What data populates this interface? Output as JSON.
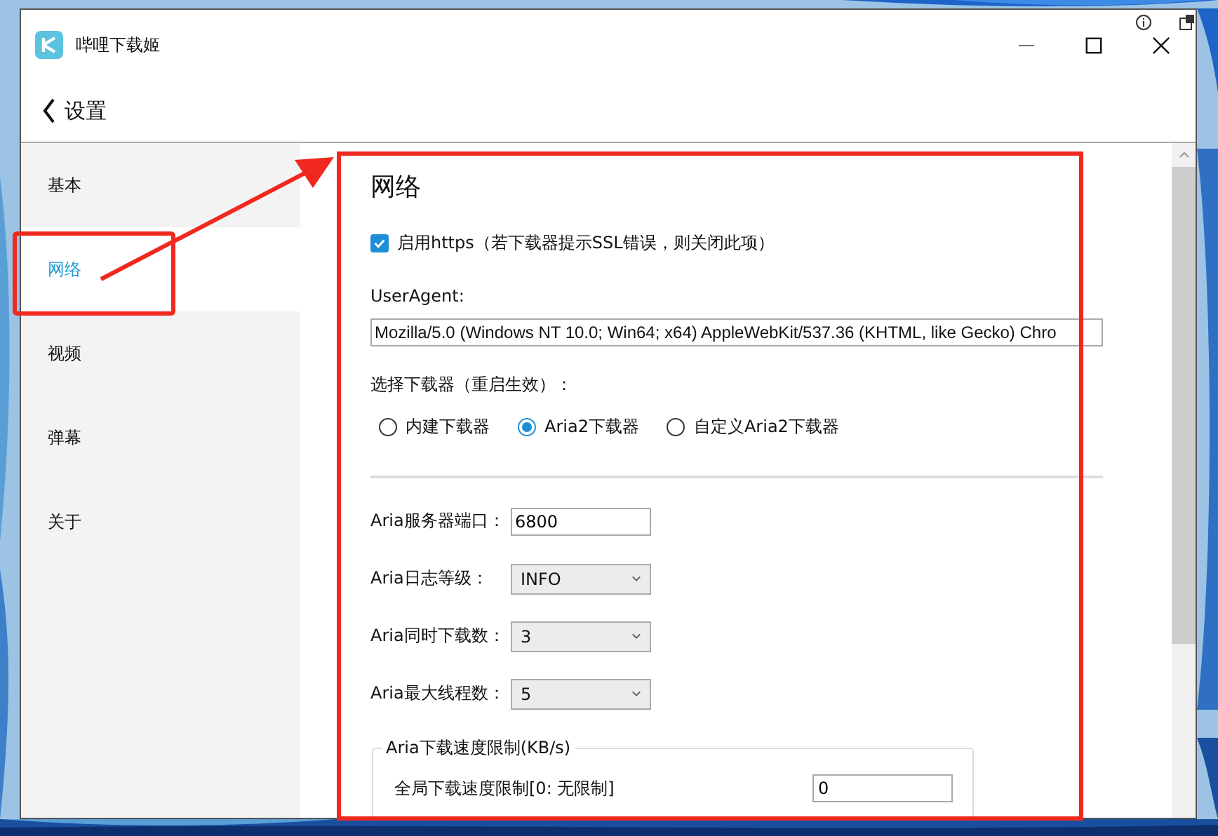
{
  "window": {
    "title": "哔哩下载姬"
  },
  "header": {
    "back_label": "设置"
  },
  "sidebar": {
    "items": [
      {
        "label": "基本",
        "selected": false
      },
      {
        "label": "网络",
        "selected": true
      },
      {
        "label": "视频",
        "selected": false
      },
      {
        "label": "弹幕",
        "selected": false
      },
      {
        "label": "关于",
        "selected": false
      }
    ]
  },
  "content": {
    "title": "网络",
    "https": {
      "label": "启用https（若下载器提示SSL错误，则关闭此项）",
      "checked": true
    },
    "useragent": {
      "label": "UserAgent:",
      "value": "Mozilla/5.0 (Windows NT 10.0; Win64; x64) AppleWebKit/537.36 (KHTML, like Gecko) Chro"
    },
    "downloader": {
      "label": "选择下载器（重启生效）：",
      "options": [
        {
          "label": "内建下载器",
          "selected": false
        },
        {
          "label": "Aria2下载器",
          "selected": true
        },
        {
          "label": "自定义Aria2下载器",
          "selected": false
        }
      ]
    },
    "settings": [
      {
        "kind": "input",
        "label": "Aria服务器端口：",
        "value": "6800"
      },
      {
        "kind": "select",
        "label": "Aria日志等级：",
        "value": "INFO"
      },
      {
        "kind": "select",
        "label": "Aria同时下载数：",
        "value": "3"
      },
      {
        "kind": "select",
        "label": "Aria最大线程数：",
        "value": "5"
      }
    ],
    "speed_limit": {
      "legend": "Aria下载速度限制(KB/s)",
      "rows": [
        {
          "label": "全局下载速度限制[0: 无限制]",
          "value": "0"
        }
      ]
    }
  }
}
